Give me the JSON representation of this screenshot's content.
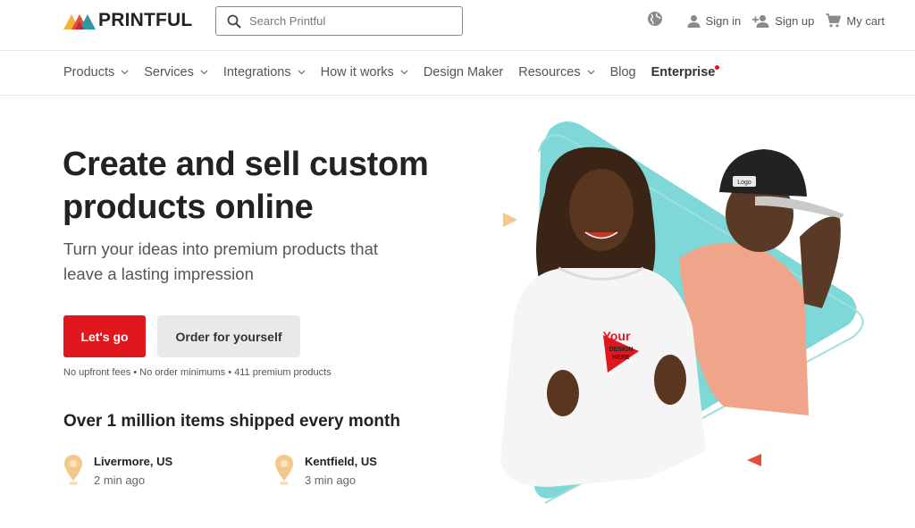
{
  "header": {
    "brand": "PRINTFUL",
    "search_placeholder": "Search Printful",
    "actions": {
      "sign_in": "Sign in",
      "sign_up": "Sign up",
      "cart": "My cart"
    }
  },
  "nav": {
    "items": [
      {
        "label": "Products",
        "has_dropdown": true
      },
      {
        "label": "Services",
        "has_dropdown": true
      },
      {
        "label": "Integrations",
        "has_dropdown": true
      },
      {
        "label": "How it works",
        "has_dropdown": true
      },
      {
        "label": "Design Maker",
        "has_dropdown": false
      },
      {
        "label": "Resources",
        "has_dropdown": true
      },
      {
        "label": "Blog",
        "has_dropdown": false
      },
      {
        "label": "Enterprise",
        "has_dropdown": false
      }
    ]
  },
  "hero": {
    "title": "Create and sell custom products online",
    "subtitle": "Turn your ideas into premium products that leave a lasting impression",
    "primary_cta": "Let's go",
    "secondary_cta": "Order for yourself",
    "fine_print": "No upfront fees • No order minimums • 411 premium products",
    "stat_heading": "Over 1 million items shipped every month",
    "locations": [
      {
        "city": "Livermore, US",
        "time": "2 min ago"
      },
      {
        "city": "Kentfield, US",
        "time": "3 min ago"
      }
    ],
    "hoodie_print": {
      "line1": "Your",
      "line2": "DESIGN",
      "line3": "HERE"
    },
    "cap_print": "Logo"
  },
  "colors": {
    "brand_red": "#e0171c",
    "accent_teal": "#7fd8d8",
    "accent_peach": "#f3c98a",
    "secondary_button": "#e9e9e9"
  }
}
